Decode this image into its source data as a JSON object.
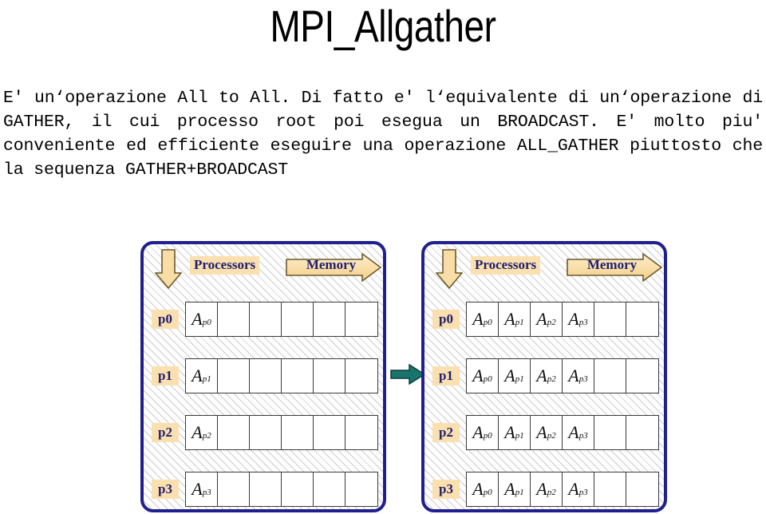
{
  "slide": {
    "title": "MPI_Allgather",
    "body": "E' un‘operazione All to All.  Di fatto e' l‘equivalente di un‘operazione di GATHER, il cui processo root poi esegua un BROADCAST.  E' molto piu' conveniente ed efficiente eseguire una operazione ALL_GATHER piuttosto che la sequenza GATHER+BROADCAST"
  },
  "diagram": {
    "flow_arrow_color": "#18756e",
    "panel_border_color": "#1f1f8f",
    "tag_background_color": "#fadfaf",
    "tag_text_color": "#1f1f6e",
    "arrow_fill_color": "#f8dda6",
    "arrow_outline_color": "#6b5a2a",
    "panels": [
      {
        "id": "before",
        "processors_label": "Processors",
        "memory_label": "Memory",
        "rows": [
          {
            "tag": "p0",
            "cells": [
              "A",
              "",
              "",
              "",
              "",
              ""
            ],
            "subs": [
              "p0",
              "",
              "",
              "",
              "",
              ""
            ]
          },
          {
            "tag": "p1",
            "cells": [
              "A",
              "",
              "",
              "",
              "",
              ""
            ],
            "subs": [
              "p1",
              "",
              "",
              "",
              "",
              ""
            ]
          },
          {
            "tag": "p2",
            "cells": [
              "A",
              "",
              "",
              "",
              "",
              ""
            ],
            "subs": [
              "p2",
              "",
              "",
              "",
              "",
              ""
            ]
          },
          {
            "tag": "p3",
            "cells": [
              "A",
              "",
              "",
              "",
              "",
              ""
            ],
            "subs": [
              "p3",
              "",
              "",
              "",
              "",
              ""
            ]
          }
        ]
      },
      {
        "id": "after",
        "processors_label": "Processors",
        "memory_label": "Memory",
        "rows": [
          {
            "tag": "p0",
            "cells": [
              "A",
              "A",
              "A",
              "A",
              "",
              ""
            ],
            "subs": [
              "p0",
              "p1",
              "p2",
              "p3",
              "",
              ""
            ]
          },
          {
            "tag": "p1",
            "cells": [
              "A",
              "A",
              "A",
              "A",
              "",
              ""
            ],
            "subs": [
              "p0",
              "p1",
              "p2",
              "p3",
              "",
              ""
            ]
          },
          {
            "tag": "p2",
            "cells": [
              "A",
              "A",
              "A",
              "A",
              "",
              ""
            ],
            "subs": [
              "p0",
              "p1",
              "p2",
              "p3",
              "",
              ""
            ]
          },
          {
            "tag": "p3",
            "cells": [
              "A",
              "A",
              "A",
              "A",
              "",
              ""
            ],
            "subs": [
              "p0",
              "p1",
              "p2",
              "p3",
              "",
              ""
            ]
          }
        ]
      }
    ]
  }
}
